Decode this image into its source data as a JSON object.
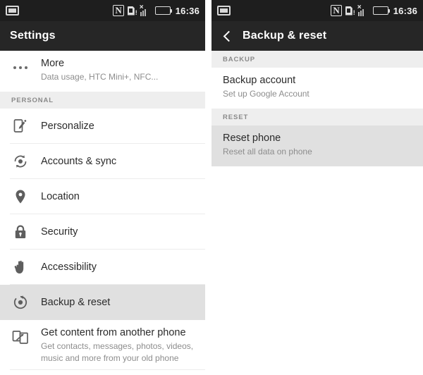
{
  "statusbar": {
    "capture_icon": "screenshot-icon",
    "nfc_label": "N",
    "sd_icon": "sd-card-warning-icon",
    "signal_icon": "signal-no-service-icon",
    "battery_icon": "battery-icon",
    "time": "16:36"
  },
  "left_screen": {
    "appbar_title": "Settings",
    "rows": [
      {
        "icon": "overflow-dots-icon",
        "title": "More",
        "subtitle": "Data usage, HTC Mini+, NFC..."
      }
    ],
    "section_personal": "PERSONAL",
    "personal_items": [
      {
        "icon": "personalize-icon",
        "title": "Personalize",
        "selected": false
      },
      {
        "icon": "sync-icon",
        "title": "Accounts & sync",
        "selected": false
      },
      {
        "icon": "location-pin-icon",
        "title": "Location",
        "selected": false
      },
      {
        "icon": "lock-icon",
        "title": "Security",
        "selected": false
      },
      {
        "icon": "hand-icon",
        "title": "Accessibility",
        "selected": false
      },
      {
        "icon": "backup-reset-icon",
        "title": "Backup & reset",
        "selected": true
      }
    ],
    "transfer_row": {
      "icon": "phone-transfer-icon",
      "title": "Get content from another phone",
      "subtitle_line1": "Get contacts, messages, photos, videos,",
      "subtitle_line2": "music and more from your old phone"
    }
  },
  "right_screen": {
    "back_icon": "back-chevron-icon",
    "appbar_title": "Backup & reset",
    "section_backup": "BACKUP",
    "backup_account": {
      "title": "Backup account",
      "subtitle": "Set up Google Account"
    },
    "section_reset": "RESET",
    "reset_phone": {
      "title": "Reset phone",
      "subtitle": "Reset all data on phone",
      "selected": true
    }
  },
  "colors": {
    "statusbar_bg": "#1e1e1e",
    "appbar_bg": "#262626",
    "section_bg": "#eeeeee",
    "selected_bg": "#e0e0e0",
    "title_text": "#2b2b2b",
    "sub_text": "#8d8d8d",
    "icon_stroke": "#5e5e5e"
  }
}
